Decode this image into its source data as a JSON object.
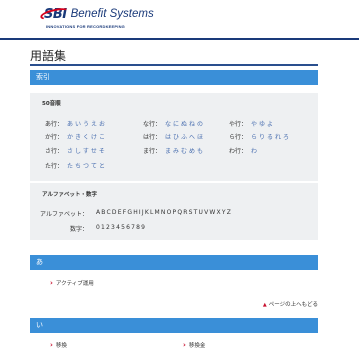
{
  "header": {
    "logo_mark": "SBI",
    "logo_name": "Benefit Systems",
    "tagline": "INNOVATIONS FOR RECORDKEEPING"
  },
  "page_title": "用語集",
  "index_bar": "索引",
  "gojuon": {
    "heading": "50音順",
    "rows": [
      [
        {
          "label": "あ行：",
          "kana": "あいうえお"
        },
        {
          "label": "な行：",
          "kana": "なにぬねの"
        },
        {
          "label": "や行：",
          "kana": "やゆよ"
        }
      ],
      [
        {
          "label": "か行：",
          "kana": "かきくけこ"
        },
        {
          "label": "は行：",
          "kana": "はひふへほ"
        },
        {
          "label": "ら行：",
          "kana": "らりるれろ"
        }
      ],
      [
        {
          "label": "さ行：",
          "kana": "さしすせそ"
        },
        {
          "label": "ま行：",
          "kana": "まみむめも"
        },
        {
          "label": "わ行：",
          "kana": "わ"
        }
      ],
      [
        {
          "label": "た行：",
          "kana": "たちつてと"
        }
      ]
    ]
  },
  "alnum": {
    "heading": "アルファベット・数字",
    "alpha_label": "アルファベット：",
    "alpha_value": "ABCDEFGHIJKLMNOPQRSTUVWXYZ",
    "digit_label": "数字：",
    "digit_value": "0123456789"
  },
  "section_a": {
    "bar": "あ",
    "items": [
      "アクティブ運用"
    ]
  },
  "back_to_top": "ページの上へもどる",
  "section_i": {
    "bar": "い",
    "items": [
      "移換",
      "移換金"
    ]
  },
  "colors": {
    "bar_blue": "#3a8fd8",
    "navy": "#1a3a7a",
    "red": "#c8102e",
    "link": "#4a6fb0"
  }
}
